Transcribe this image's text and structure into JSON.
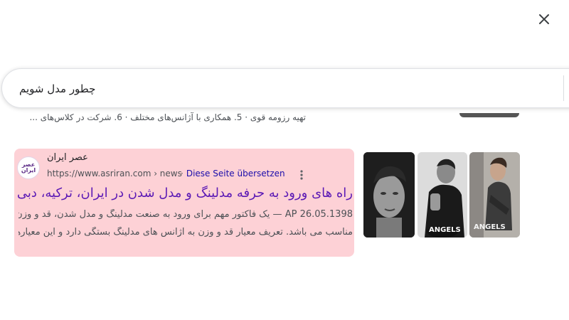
{
  "search": {
    "query": "چطور مدل شویم",
    "clear_icon": "close-icon"
  },
  "previous_result": {
    "snippet": "تهیه رزومه قوی · 5. همکاری با آژانس‌های مختلف · 6. شرکت در کلاس‌های ..."
  },
  "result": {
    "favicon_text": "عصر ایران",
    "site_name": "عصر ایران",
    "url": "https://www.asriran.com › news",
    "translate_link": "Diese Seite übersetzen",
    "title": "راه های ورود به حرفه مدلینگ و مدل شدن در ایران، ترکیه، دبی",
    "snippet_line1": "26.05.1398 AP — یک فاکتور مهم برای ورود به صنعت مدلینگ و مدل شدن، قد و وزن",
    "snippet_line2": "مناسب می باشد. تعریف معیار قد و وزن به آژانس های مدلینگ بستگی دارد و این معیارها ...",
    "highlight_color": "#fdd1d6",
    "title_color": "#5b19b5"
  },
  "thumbnails": [
    {
      "name": "portrait-thumbnail"
    },
    {
      "name": "man-in-suit-thumbnail",
      "caption": "ANGELS"
    },
    {
      "name": "seated-man-thumbnail",
      "caption": "ANGELS"
    }
  ]
}
